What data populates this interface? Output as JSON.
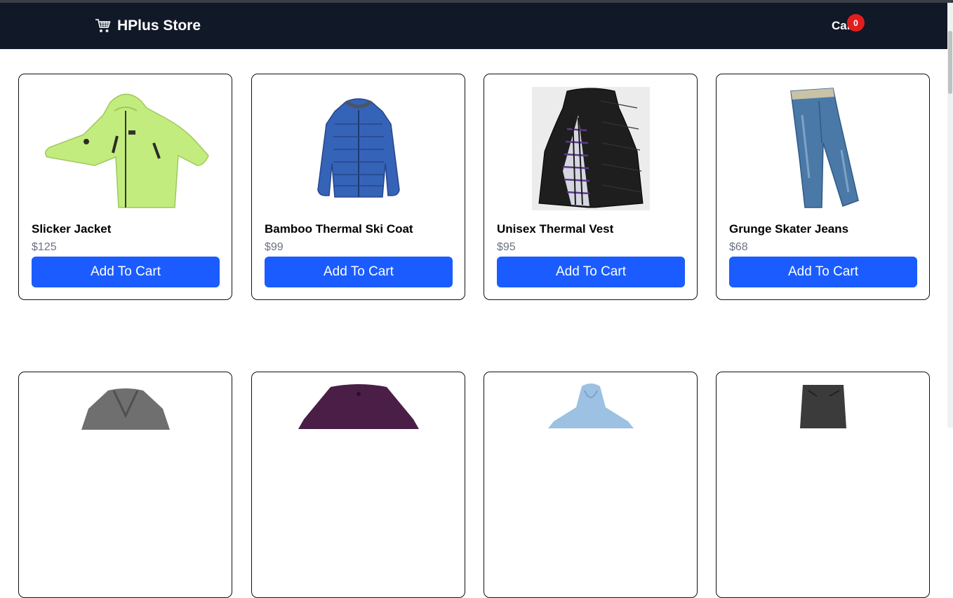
{
  "header": {
    "brand": "HPlus Store",
    "brand_icon": "shopping-cart-icon",
    "cart_label": "Cart",
    "cart_count": "0"
  },
  "colors": {
    "navbar": "#111827",
    "button": "#1a5cff",
    "badge": "#e11d1d",
    "price": "#6b7280"
  },
  "products": [
    {
      "name": "Slicker Jacket",
      "price": "$125",
      "button": "Add To Cart",
      "image": "lime-rain-jacket"
    },
    {
      "name": "Bamboo Thermal Ski Coat",
      "price": "$99",
      "button": "Add To Cart",
      "image": "blue-puffer-coat"
    },
    {
      "name": "Unisex Thermal Vest",
      "price": "$95",
      "button": "Add To Cart",
      "image": "black-puffer-vest"
    },
    {
      "name": "Grunge Skater Jeans",
      "price": "$68",
      "button": "Add To Cart",
      "image": "blue-jeans"
    }
  ],
  "products_row2": [
    {
      "image": "gray-cardigan"
    },
    {
      "image": "purple-sweater"
    },
    {
      "image": "light-blue-hoodie"
    },
    {
      "image": "gray-pants"
    }
  ]
}
